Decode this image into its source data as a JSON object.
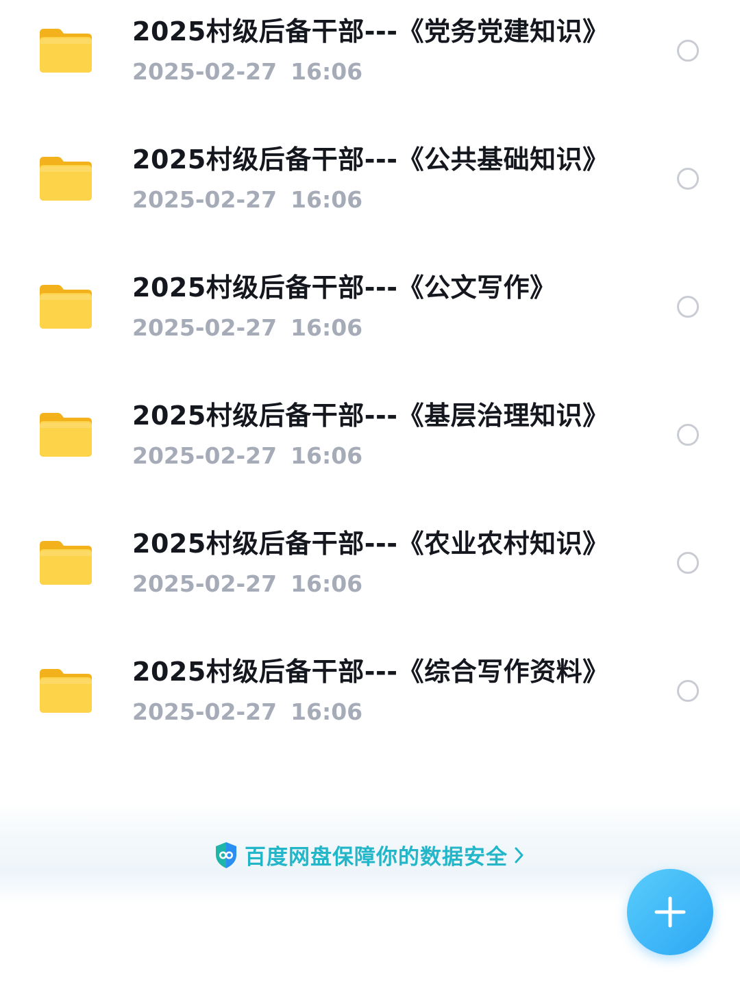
{
  "file_list": {
    "items": [
      {
        "name": "2025村级后备干部---《党务党建知识》",
        "date": "2025-02-27",
        "time": "16:06",
        "icon": "folder-icon",
        "type": "folder"
      },
      {
        "name": "2025村级后备干部---《公共基础知识》",
        "date": "2025-02-27",
        "time": "16:06",
        "icon": "folder-icon",
        "type": "folder"
      },
      {
        "name": "2025村级后备干部---《公文写作》",
        "date": "2025-02-27",
        "time": "16:06",
        "icon": "folder-icon",
        "type": "folder"
      },
      {
        "name": "2025村级后备干部---《基层治理知识》",
        "date": "2025-02-27",
        "time": "16:06",
        "icon": "folder-icon",
        "type": "folder"
      },
      {
        "name": "2025村级后备干部---《农业农村知识》",
        "date": "2025-02-27",
        "time": "16:06",
        "icon": "folder-icon",
        "type": "folder"
      },
      {
        "name": "2025村级后备干部---《综合写作资料》",
        "date": "2025-02-27",
        "time": "16:06",
        "icon": "folder-icon",
        "type": "folder"
      }
    ]
  },
  "footer": {
    "security_text": "百度网盘保障你的数据安全",
    "security_icon": "shield-icon",
    "chevron_icon": "chevron-right-icon"
  },
  "fab": {
    "icon": "plus-icon"
  },
  "colors": {
    "folder_yellow": "#f9c62c",
    "title_text": "#15171f",
    "date_text": "#a6abb8",
    "radio_border": "#c9ccd3",
    "security_teal": "#22b6c8",
    "fab_blue": "#2da7f5"
  }
}
